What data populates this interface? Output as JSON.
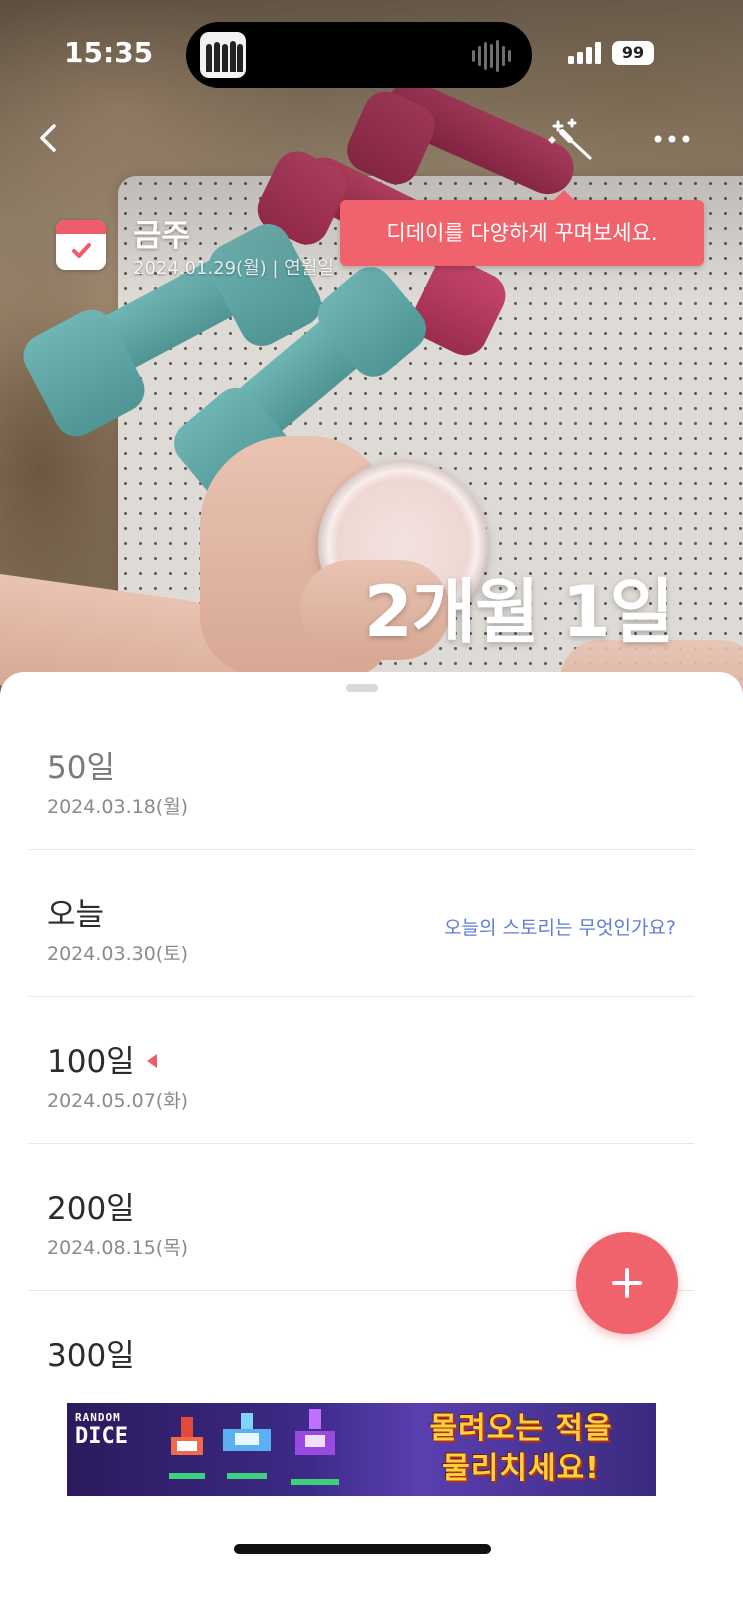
{
  "status_bar": {
    "time": "15:35",
    "battery": "99"
  },
  "header": {
    "title": "금주",
    "subtitle": "2024.01.29(월)  |  연월일"
  },
  "tooltip": "디데이를 다양하게 꾸며보세요.",
  "counter": "2개월 1일",
  "milestones": [
    {
      "label": "50일",
      "date": "2024.03.18(월)"
    },
    {
      "label": "오늘",
      "date": "2024.03.30(토)",
      "prompt": "오늘의 스토리는 무엇인가요?"
    },
    {
      "label": "100일",
      "date": "2024.05.07(화)"
    },
    {
      "label": "200일",
      "date": "2024.08.15(목)"
    },
    {
      "label": "300일"
    }
  ],
  "ad": {
    "logo_small": "RANDOM",
    "logo_big": "DICE",
    "text_line1": "몰려오는 적을",
    "text_line2": "물리치세요!"
  },
  "colors": {
    "accent": "#f0636c",
    "link": "#5d7ed6"
  },
  "icons": [
    "back-chevron-icon",
    "magic-wand-icon",
    "more-icon",
    "calendar-check-icon",
    "plus-icon"
  ]
}
